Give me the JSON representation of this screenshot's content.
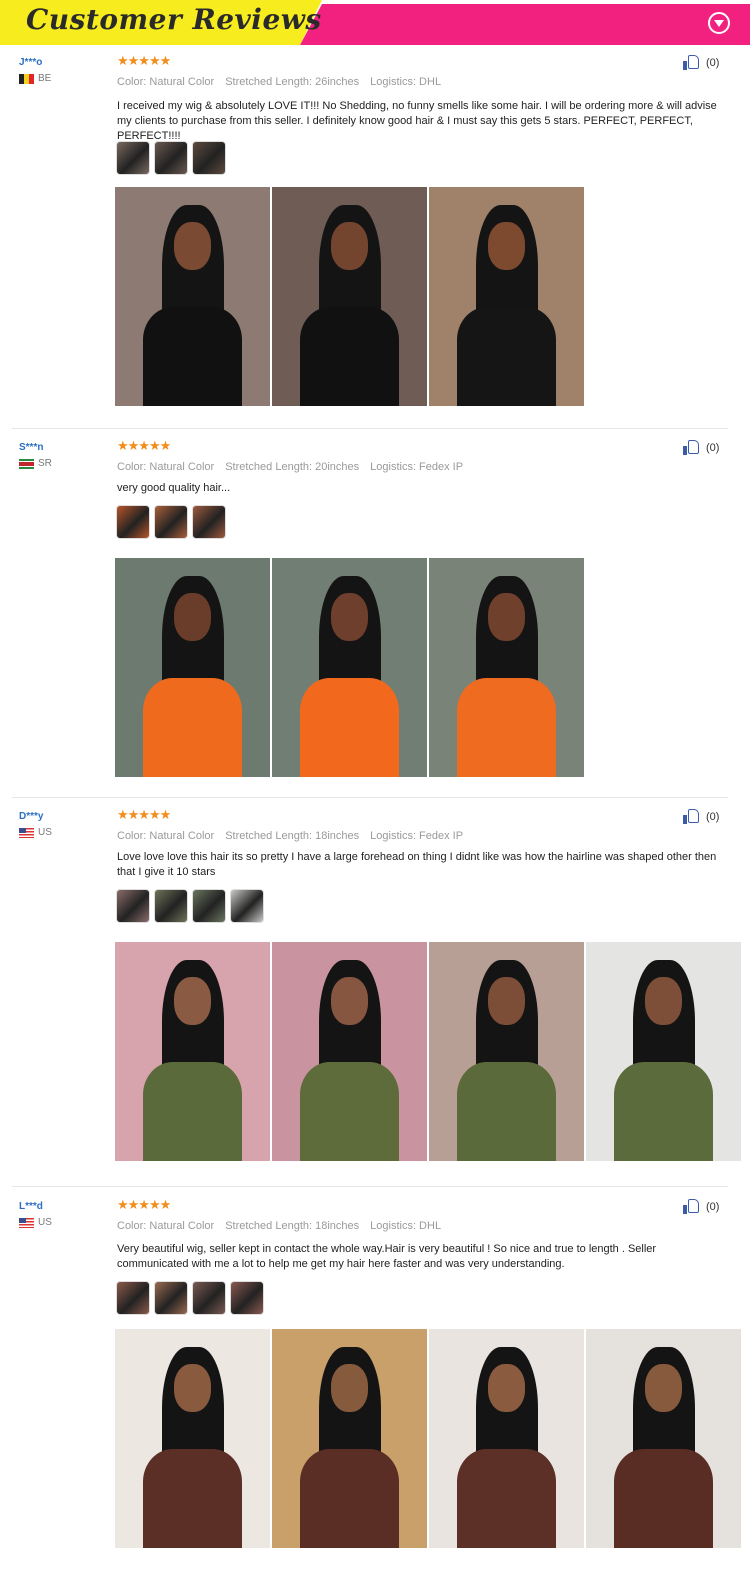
{
  "header": {
    "title": "Customer Reviews"
  },
  "reviews": [
    {
      "user": "J***o",
      "country": "BE",
      "flag": "be",
      "rating": "★★★★★",
      "color": "Color: Natural Color",
      "length": "Stretched Length: 26inches",
      "logistics": "Logistics: DHL",
      "text": "I received my wig & absolutely LOVE IT!!! No Shedding, no funny smells like some hair. I will be ordering more & will advise my clients to purchase from this seller. I definitely know good hair & I must say this gets 5 stars. PERFECT, PERFECT, PERFECT!!!!",
      "likes": "(0)",
      "thumbs": [
        "#7a6a60",
        "#6b5a50",
        "#5e4a3e"
      ],
      "photos": [
        {
          "bg": "#8d7b73",
          "skin": "#7a4a32",
          "top": "#111111"
        },
        {
          "bg": "#6e5c55",
          "skin": "#74452e",
          "top": "#111111"
        },
        {
          "bg": "#a0826b",
          "skin": "#7d4a30",
          "top": "#151515"
        }
      ]
    },
    {
      "user": "S***n",
      "country": "SR",
      "flag": "sr",
      "rating": "★★★★★",
      "color": "Color: Natural Color",
      "length": "Stretched Length: 20inches",
      "logistics": "Logistics: Fedex IP",
      "text": "very good quality hair...",
      "likes": "(0)",
      "thumbs": [
        "#b8552a",
        "#a9603a",
        "#9d5a3e"
      ],
      "photos": [
        {
          "bg": "#6c7a70",
          "skin": "#6a3d2a",
          "top": "#f06a1e"
        },
        {
          "bg": "#707e74",
          "skin": "#6d3f2c",
          "top": "#f2691d"
        },
        {
          "bg": "#7a8378",
          "skin": "#6f402c",
          "top": "#ef6b20"
        }
      ]
    },
    {
      "user": "D***y",
      "country": "US",
      "flag": "us",
      "rating": "★★★★★",
      "color": "Color: Natural Color",
      "length": "Stretched Length: 18inches",
      "logistics": "Logistics: Fedex IP",
      "text": "Love love love this hair its so pretty I have a large forehead on thing I didnt like was how the hairline was shaped other then that I give it 10 stars",
      "likes": "(0)",
      "thumbs": [
        "#8a6d6a",
        "#6f7358",
        "#6a7660",
        "#c9c9c6"
      ],
      "photos": [
        {
          "bg": "#d7a3ad",
          "skin": "#8a5a42",
          "top": "#5b6a3b"
        },
        {
          "bg": "#c994a0",
          "skin": "#865640",
          "top": "#5e6c3c"
        },
        {
          "bg": "#b79f95",
          "skin": "#7c4e38",
          "top": "#5a6a3a"
        },
        {
          "bg": "#e4e4e2",
          "skin": "#7e4f38",
          "top": "#5c6b3b"
        }
      ]
    },
    {
      "user": "L***d",
      "country": "US",
      "flag": "us",
      "rating": "★★★★★",
      "color": "Color: Natural Color",
      "length": "Stretched Length: 18inches",
      "logistics": "Logistics: DHL",
      "text": "Very beautiful wig, seller kept in contact the whole way.Hair is very beautiful ! So nice and true to length . Seller communicated with me a lot to help me get my hair here faster and was very understanding.",
      "likes": "(0)",
      "thumbs": [
        "#8c5a4a",
        "#9a6a50",
        "#7a5a52",
        "#8a5a50"
      ],
      "photos": [
        {
          "bg": "#ede7e2",
          "skin": "#8a5a3e",
          "top": "#5b2f26"
        },
        {
          "bg": "#c9a06a",
          "skin": "#865a3c",
          "top": "#5a2e25"
        },
        {
          "bg": "#e9e4e0",
          "skin": "#8b5b3f",
          "top": "#5c3026"
        },
        {
          "bg": "#e5e1dc",
          "skin": "#875a3e",
          "top": "#592d24"
        }
      ]
    }
  ]
}
